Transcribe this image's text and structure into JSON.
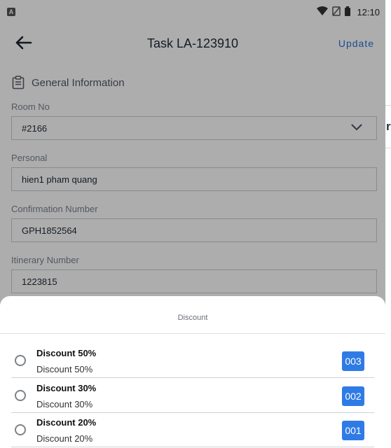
{
  "status_bar": {
    "app_badge": "A",
    "time": "12:10"
  },
  "header": {
    "title": "Task LA-123910",
    "update_label": "Update"
  },
  "general": {
    "section_title": "General Information",
    "fields": [
      {
        "label": "Room No",
        "value": "#2166"
      },
      {
        "label": "Personal",
        "value": "hien1 pham quang"
      },
      {
        "label": "Confirmation Number",
        "value": "GPH1852564"
      },
      {
        "label": "Itinerary Number",
        "value": "1223815"
      }
    ]
  },
  "side_peek_text": "r",
  "discount_sheet": {
    "title": "Discount",
    "items": [
      {
        "title": "Discount 50%",
        "subtitle": "Discount 50%",
        "code": "003"
      },
      {
        "title": "Discount 30%",
        "subtitle": "Discount 30%",
        "code": "002"
      },
      {
        "title": "Discount 20%",
        "subtitle": "Discount 20%",
        "code": "001"
      }
    ]
  },
  "colors": {
    "accent": "#2f7be6",
    "update_link": "#2f6fd3",
    "scrim": "rgba(0,0,0,0.32)"
  }
}
